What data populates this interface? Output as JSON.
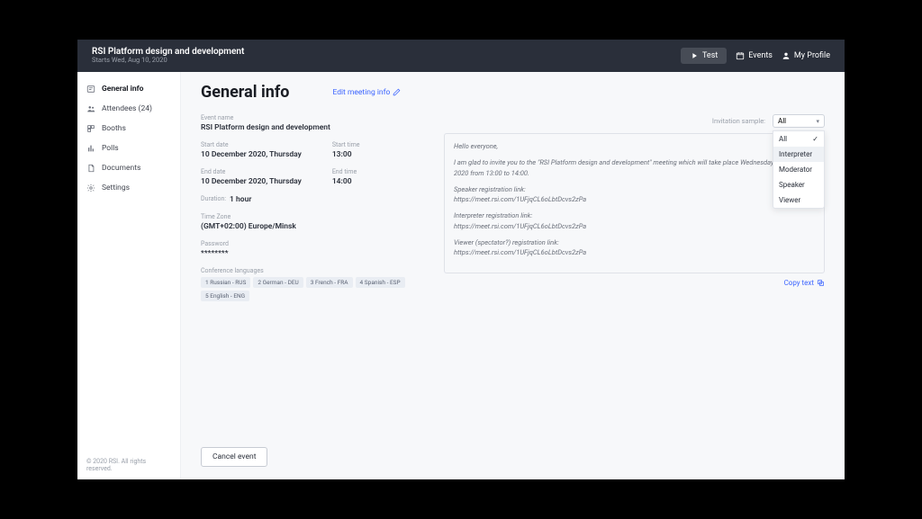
{
  "header": {
    "title": "RSI Platform design and development",
    "subtitle": "Starts Wed, Aug 10, 2020",
    "test_label": "Test",
    "events_label": "Events",
    "profile_label": "My Profile"
  },
  "sidebar": {
    "items": [
      {
        "label": "General info"
      },
      {
        "label": "Attendees (24)"
      },
      {
        "label": "Booths"
      },
      {
        "label": "Polls"
      },
      {
        "label": "Documents"
      },
      {
        "label": "Settings"
      }
    ],
    "footer": "© 2020 RSI. All rights reserved."
  },
  "page": {
    "title": "General info",
    "edit": "Edit meeting info"
  },
  "event": {
    "name_label": "Event name",
    "name": "RSI Platform design and development",
    "start_date_label": "Start date",
    "start_date": "10 December 2020, Thursday",
    "start_time_label": "Start time",
    "start_time": "13:00",
    "end_date_label": "End date",
    "end_date": "10 December 2020, Thursday",
    "end_time_label": "End time",
    "end_time": "14:00",
    "duration_label": "Duration:",
    "duration": "1 hour",
    "timezone_label": "Time Zone",
    "timezone": "(GMT+02:00) Europe/Minsk",
    "password_label": "Password",
    "password": "********",
    "langs_label": "Conference languages",
    "langs": [
      "1 Russian - RUS",
      "2 German - DEU",
      "3 French - FRA",
      "4 Spanish - ESP",
      "5 English - ENG"
    ]
  },
  "invitation": {
    "sample_label": "Invitation sample:",
    "selected": "All",
    "options": [
      "All",
      "Interpreter",
      "Moderator",
      "Speaker",
      "Viewer"
    ],
    "highlighted": "Interpreter",
    "lines": [
      "Hello everyone,",
      "I am glad to invite you to the \"RSI Platform design and development\" meeting which will take place Wednesday 10. August 2020 from 13:00 to 14:00.",
      "Speaker registration link:\nhttps://meet.rsi.com/1UFjqCL6oLbtDcvs2zPa",
      "Interpreter registration link:\nhttps://meet.rsi.com/1UFjqCL6oLbtDcvs2zPa",
      "Viewer (spectator?) registration link:\nhttps://meet.rsi.com/1UFjqCL6oLbtDcvs2zPa"
    ],
    "copy": "Copy text"
  },
  "actions": {
    "cancel": "Cancel event"
  }
}
